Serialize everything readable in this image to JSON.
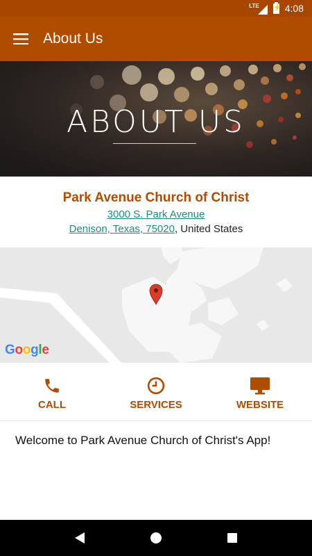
{
  "status_bar": {
    "network": "LTE",
    "time": "4:08",
    "battery_glyph": "⚡"
  },
  "app_bar": {
    "title": "About Us",
    "menu_icon": "hamburger-menu-icon"
  },
  "hero": {
    "title": "ABOUT US"
  },
  "church": {
    "name": "Park Avenue Church of Christ",
    "street": "3000 S. Park Avenue",
    "city_line": "Denison, Texas, 75020",
    "country_suffix": ", United States"
  },
  "map": {
    "logo": [
      "G",
      "o",
      "o",
      "g",
      "l",
      "e"
    ],
    "logo_colors": [
      "#4285F4",
      "#EA4335",
      "#FBBC05",
      "#4285F4",
      "#34A853",
      "#EA4335"
    ]
  },
  "actions": [
    {
      "label": "CALL",
      "icon": "phone-icon"
    },
    {
      "label": "SERVICES",
      "icon": "clock-icon"
    },
    {
      "label": "WEBSITE",
      "icon": "monitor-icon"
    }
  ],
  "welcome_text": "Welcome to Park Avenue Church of Christ's App!",
  "colors": {
    "primary": "#b04c00",
    "status_bar": "#a84600",
    "link": "#19907d"
  }
}
